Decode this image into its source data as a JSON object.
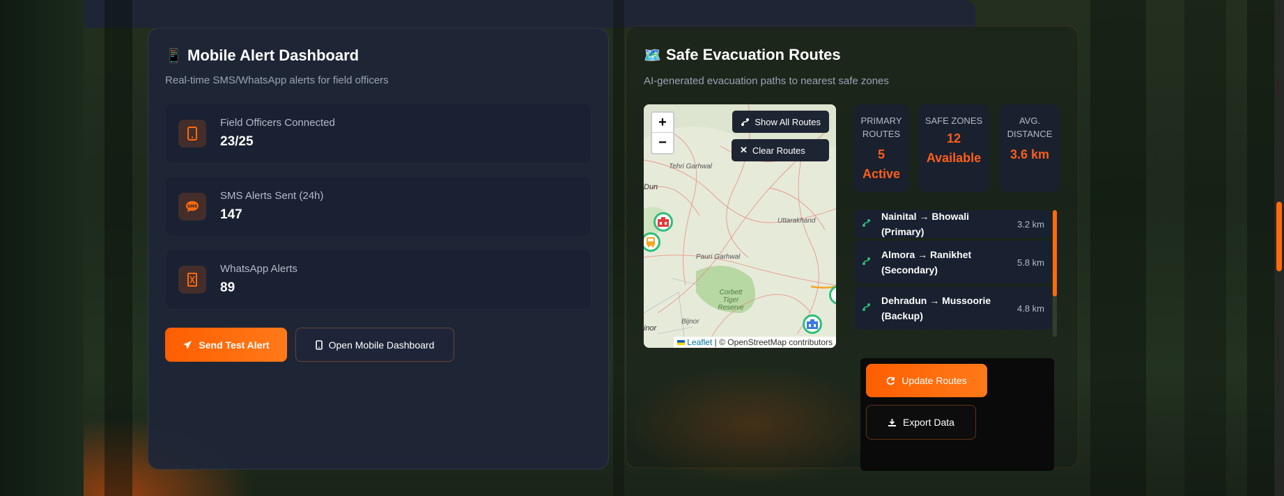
{
  "mobile_dashboard": {
    "icon": "📱",
    "title": "Mobile Alert Dashboard",
    "subtitle": "Real-time SMS/WhatsApp alerts for field officers",
    "stats": [
      {
        "icon": "mobile-icon",
        "label": "Field Officers Connected",
        "value": "23/25"
      },
      {
        "icon": "sms-icon",
        "label": "SMS Alerts Sent (24h)",
        "value": "147"
      },
      {
        "icon": "whatsapp-icon",
        "label": "WhatsApp Alerts",
        "value": "89"
      }
    ],
    "buttons": {
      "send_test": "Send Test Alert",
      "open_mobile": "Open Mobile Dashboard"
    }
  },
  "evacuation": {
    "icon": "🗺️",
    "title": "Safe Evacuation Routes",
    "subtitle": "AI-generated evacuation paths to nearest safe zones",
    "map": {
      "zoom_in": "+",
      "zoom_out": "−",
      "show_all_routes": "Show All Routes",
      "clear_routes": "Clear Routes",
      "attribution_leaflet": "Leaflet",
      "attribution_rest": "| © OpenStreetMap contributors",
      "place_labels": [
        "Tehri Garhwal",
        "Uttarakhand",
        "Pauri Garhwal",
        "Corbett Tiger Reserve",
        "Bijnor",
        "Dun",
        "inor"
      ]
    },
    "summary": [
      {
        "label": "PRIMARY ROUTES",
        "value_line1": "5",
        "value_line2": "Active"
      },
      {
        "label": "SAFE ZONES",
        "value_line1": "12",
        "value_line2": "Available"
      },
      {
        "label": "AVG. DISTANCE",
        "value_line1": "3.6 km",
        "value_line2": ""
      }
    ],
    "routes": [
      {
        "name": "Nainital → Bhowali (Primary)",
        "distance": "3.2 km"
      },
      {
        "name": "Almora → Ranikhet (Secondary)",
        "distance": "5.8 km"
      },
      {
        "name": "Dehradun → Mussoorie (Backup)",
        "distance": "4.8 km"
      }
    ],
    "buttons": {
      "update_routes": "Update Routes",
      "export_data": "Export Data"
    }
  },
  "colors": {
    "accent": "#ff6a0d",
    "route_icon": "#2dbf7a",
    "panel_bg": "#1e2638"
  }
}
